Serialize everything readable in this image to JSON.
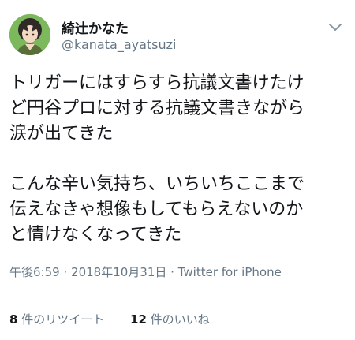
{
  "user": {
    "display_name": "綺辻かなた",
    "handle": "@kanata_ayatsuzi"
  },
  "tweet": {
    "lines": [
      "トリガーにはすらすら抗議文書けたけ",
      "ど円谷プロに対する抗議文書きながら",
      "涙が出てきた",
      "",
      "こんな辛い気持ち、いちいちここまで",
      "伝えなきゃ想像もしてもらえないのか",
      "と情けなくなってきた"
    ]
  },
  "meta": {
    "time": "午後6:59",
    "separator": "·",
    "date": "2018年10月31日",
    "source": "Twitter for iPhone"
  },
  "stats": {
    "retweets_count": "8",
    "retweets_label": "件のリツイート",
    "likes_count": "12",
    "likes_label": "件のいいね"
  },
  "icons": {
    "menu": "chevron-down-icon"
  }
}
